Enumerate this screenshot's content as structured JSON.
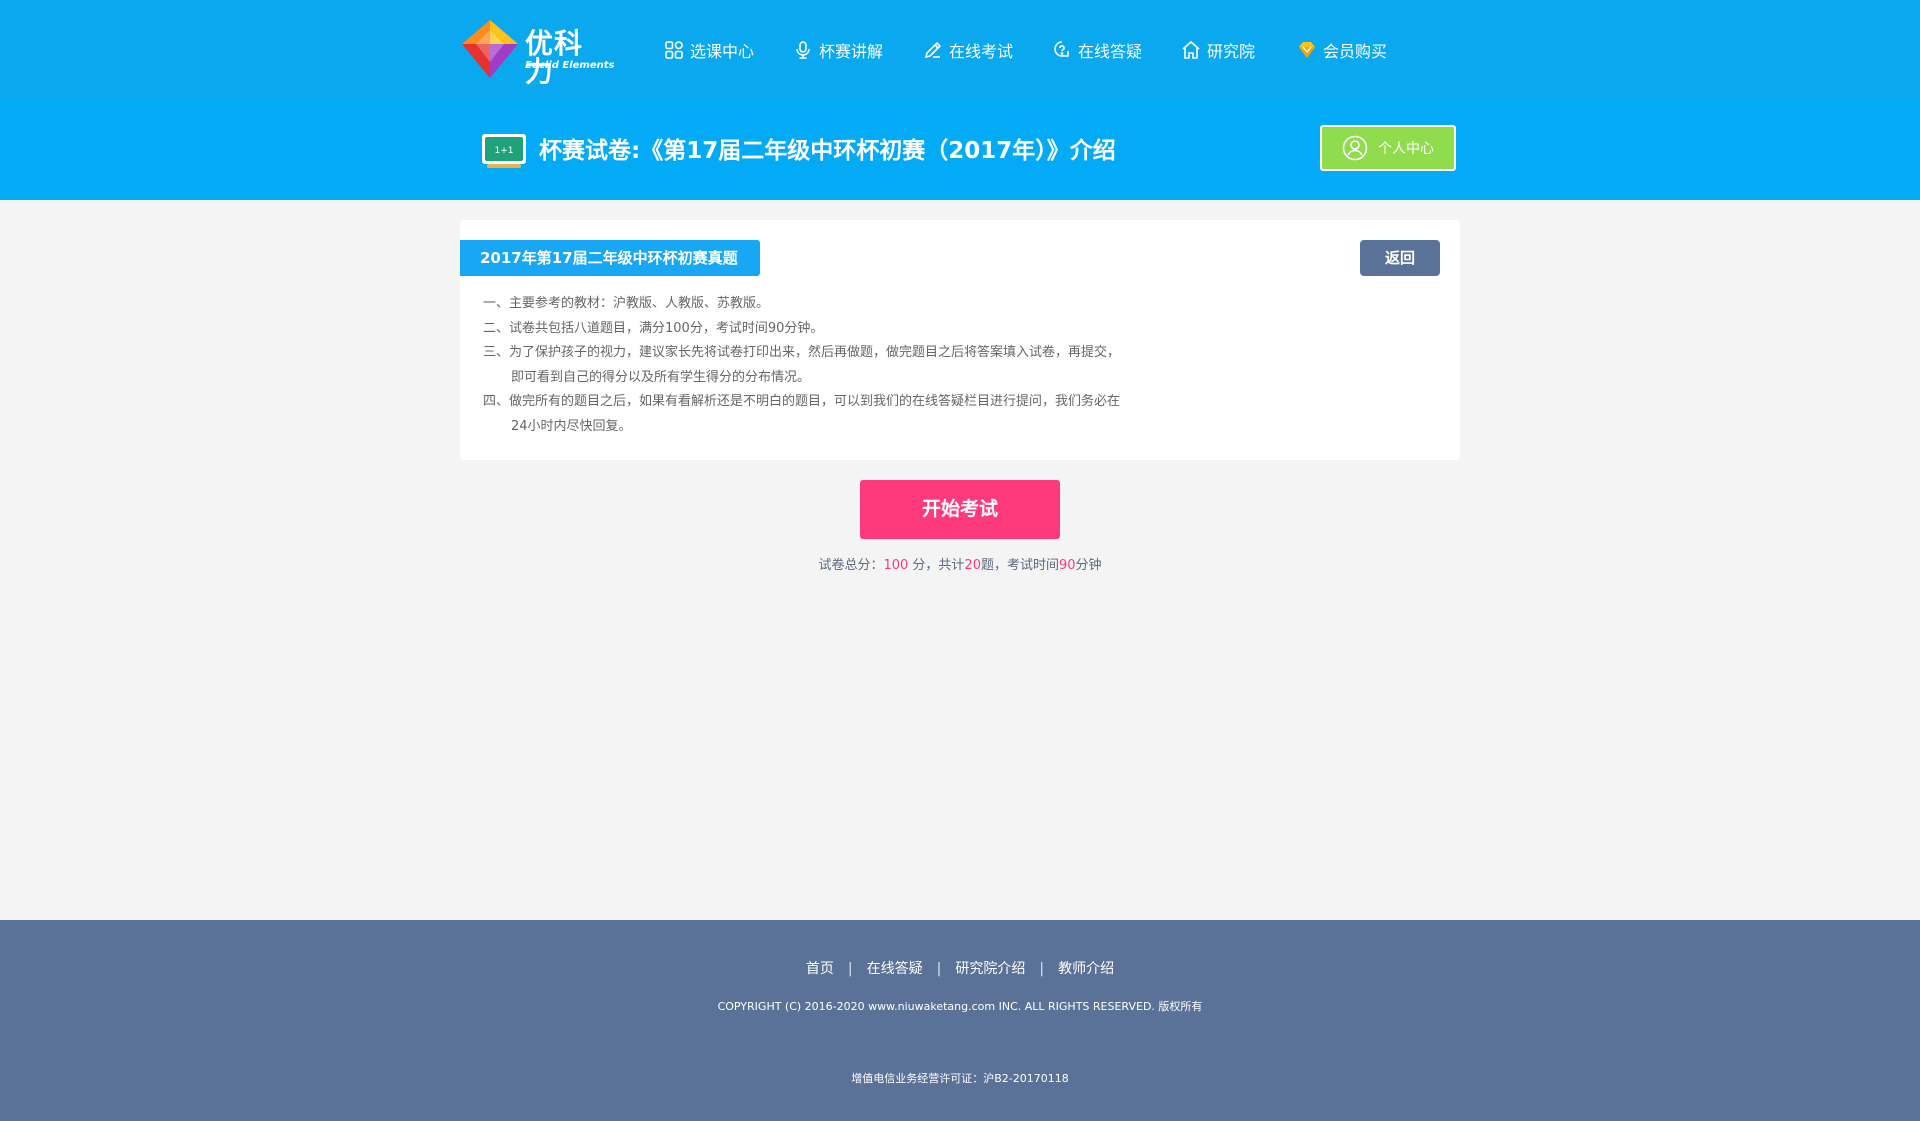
{
  "brand": {
    "logo_text": "优科力",
    "logo_subtitle": "Euclid Elements"
  },
  "nav": {
    "items": [
      {
        "label": "选课中心",
        "icon": "grid-icon"
      },
      {
        "label": "杯赛讲解",
        "icon": "microphone-icon"
      },
      {
        "label": "在线考试",
        "icon": "pencil-icon"
      },
      {
        "label": "在线答疑",
        "icon": "question-bubble-icon"
      },
      {
        "label": "研究院",
        "icon": "house-icon"
      },
      {
        "label": "会员购买",
        "icon": "diamond-icon"
      }
    ]
  },
  "banner": {
    "title": "杯赛试卷:《第17届二年级中环杯初赛（2017年）》介绍",
    "board_text": "1+1",
    "user_center_label": "个人中心"
  },
  "card": {
    "paper_name": "2017年第17届二年级中环杯初赛真题",
    "back_label": "返回",
    "rules": [
      "一、主要参考的教材：沪教版、人教版、苏教版。",
      "二、试卷共包括八道题目，满分100分，考试时间90分钟。",
      "三、为了保护孩子的视力，建议家长先将试卷打印出来，然后再做题，做完题目之后将答案填入试卷，再提交，",
      "即可看到自己的得分以及所有学生得分的分布情况。",
      "四、做完所有的题目之后，如果有看解析还是不明白的题目，可以到我们的在线答疑栏目进行提问，我们务必在",
      "24小时内尽快回复。"
    ]
  },
  "exam": {
    "start_label": "开始考试",
    "summary_prefix": "试卷总分：",
    "total_score": "100",
    "score_unit": " 分，共计",
    "question_count": "20",
    "question_unit": "题，考试时间",
    "duration": "90",
    "duration_unit": "分钟"
  },
  "footer": {
    "links": [
      "首页",
      "在线答疑",
      "研究院介绍",
      "教师介绍"
    ],
    "separator": "|",
    "copyright": "COPYRIGHT (C) 2016-2020 www.niuwaketang.com INC. ALL RIGHTS RESERVED. 版权所有",
    "license": "增值电信业务经营许可证：沪B2-20170118"
  },
  "colors": {
    "nav_bg": "#0aa8ee",
    "banner_bg": "#03aaf6",
    "accent_green": "#8fdc4c",
    "accent_pink": "#fe3a7d",
    "tag_blue": "#17a7f4",
    "slate": "#5a7198"
  }
}
